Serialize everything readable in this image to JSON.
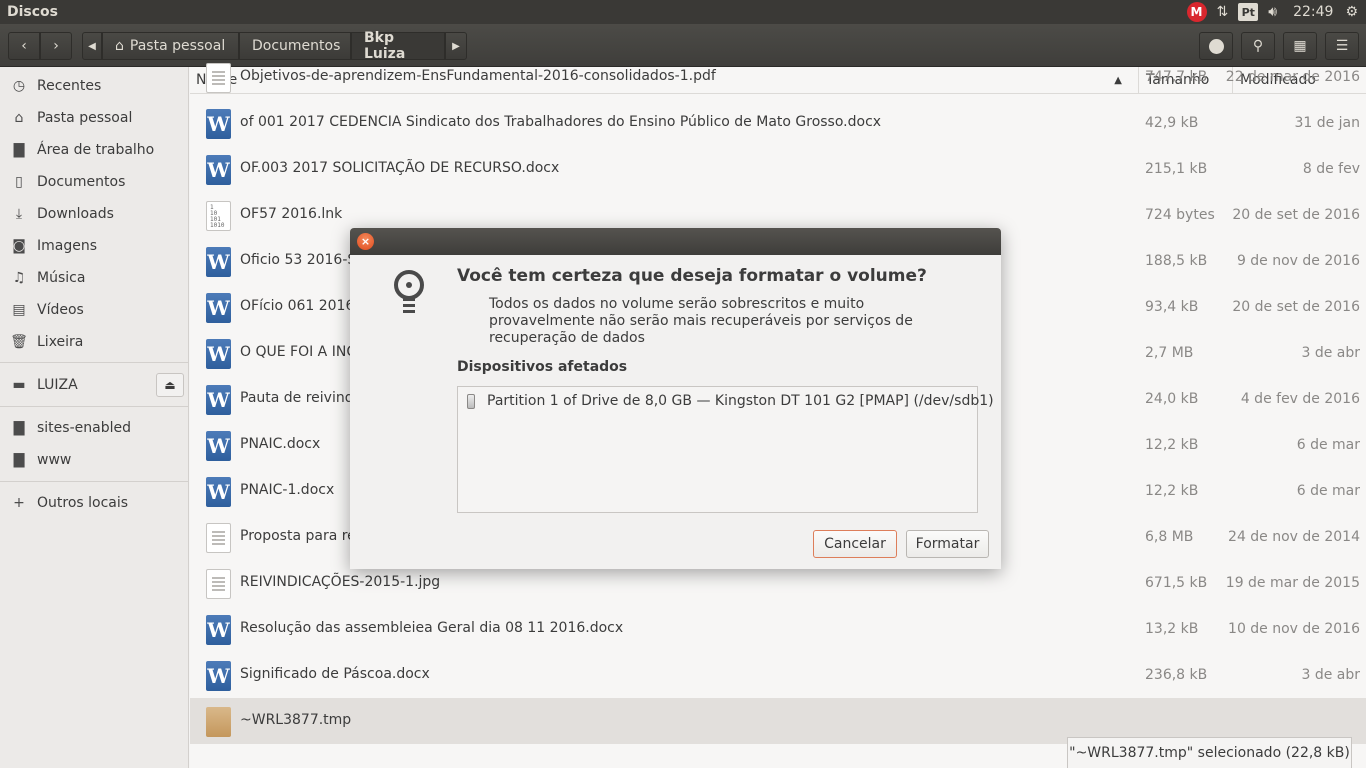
{
  "topbar": {
    "app_title": "Discos",
    "mega_label": "M",
    "keyboard_layout": "Pt",
    "time": "22:49",
    "icons": [
      "mega-icon",
      "network-arrows-icon",
      "keyboard-icon",
      "volume-icon",
      "settings-gear-icon"
    ]
  },
  "header": {
    "back_label": "‹",
    "forward_label": "›",
    "crumbs": [
      "Pasta pessoal",
      "Documentos",
      "Bkp Luiza"
    ],
    "active_crumb": "Bkp Luiza"
  },
  "sidebar": {
    "items": [
      {
        "label": "Recentes",
        "icon": "clock-icon"
      },
      {
        "label": "Pasta pessoal",
        "icon": "home-icon"
      },
      {
        "label": "Área de trabalho",
        "icon": "folder-icon"
      },
      {
        "label": "Documentos",
        "icon": "document-icon"
      },
      {
        "label": "Downloads",
        "icon": "download-icon"
      },
      {
        "label": "Imagens",
        "icon": "camera-icon"
      },
      {
        "label": "Música",
        "icon": "music-icon"
      },
      {
        "label": "Vídeos",
        "icon": "film-icon"
      },
      {
        "label": "Lixeira",
        "icon": "trash-icon"
      }
    ],
    "device": {
      "label": "LUIZA",
      "icon": "drive-icon"
    },
    "bookmarks": [
      {
        "label": "sites-enabled",
        "icon": "folder-icon"
      },
      {
        "label": "www",
        "icon": "folder-icon"
      }
    ],
    "other": {
      "label": "Outros locais",
      "icon": "plus-icon"
    }
  },
  "columns": {
    "name": "Nome",
    "size": "Tamanho",
    "modified": "Modificado"
  },
  "files": [
    {
      "name": "Objetivos-de-aprendizem-EnsFundamental-2016-consolidados-1.pdf",
      "size": "747,7 kB",
      "date": "22 de mar de 2016",
      "type": "doc"
    },
    {
      "name": "of 001  2017 CEDENCIA Sindicato dos Trabalhadores do Ensino Público de Mato Grosso.docx",
      "size": "42,9 kB",
      "date": "31 de jan",
      "type": "word"
    },
    {
      "name": "OF.003 2017 SOLICITAÇÃO DE RECURSO.docx",
      "size": "215,1 kB",
      "date": "8 de fev",
      "type": "word"
    },
    {
      "name": "OF57 2016.lnk",
      "size": "724 bytes",
      "date": "20 de set de 2016",
      "type": "binary"
    },
    {
      "name": "Oficio 53 2016-Se",
      "size": "188,5 kB",
      "date": "9 de nov de 2016",
      "type": "word"
    },
    {
      "name": "OFício  061 2016",
      "size": "93,4 kB",
      "date": "20 de set de 2016",
      "type": "word"
    },
    {
      "name": "O QUE FOI A INC",
      "size": "2,7 MB",
      "date": "3 de abr",
      "type": "word"
    },
    {
      "name": "Pauta de reivind",
      "size": "24,0 kB",
      "date": "4 de fev de 2016",
      "type": "word"
    },
    {
      "name": "PNAIC.docx",
      "size": "12,2 kB",
      "date": "6 de mar",
      "type": "word"
    },
    {
      "name": "PNAIC-1.docx",
      "size": "12,2 kB",
      "date": "6 de mar",
      "type": "word"
    },
    {
      "name": "Proposta para re",
      "size": "6,8 MB",
      "date": "24 de nov de 2014",
      "type": "doc"
    },
    {
      "name": "REIVINDICAÇÕES-2015-1.jpg",
      "size": "671,5 kB",
      "date": "19 de mar de 2015",
      "type": "doc"
    },
    {
      "name": "Resolução das assembleiea Geral dia 08 11 2016.docx",
      "size": "13,2 kB",
      "date": "10 de nov de 2016",
      "type": "word"
    },
    {
      "name": "Significado de Páscoa.docx",
      "size": "236,8 kB",
      "date": "3 de abr",
      "type": "word"
    },
    {
      "name": "~WRL3877.tmp",
      "size": "",
      "date": "",
      "type": "box"
    }
  ],
  "status": "\"~WRL3877.tmp\" selecionado  (22,8 kB)",
  "dialog": {
    "heading": "Você tem certeza que deseja formatar o volume?",
    "body": "Todos os dados no volume serão sobrescritos e muito provavelmente não serão mais recuperáveis por serviços de recuperação de dados",
    "affected_label": "Dispositivos afetados",
    "device": "Partition 1 of Drive de 8,0 GB — Kingston DT 101 G2 [PMAP] (/dev/sdb1)",
    "cancel_label": "Cancelar",
    "format_label": "Formatar",
    "close_label": "×"
  }
}
